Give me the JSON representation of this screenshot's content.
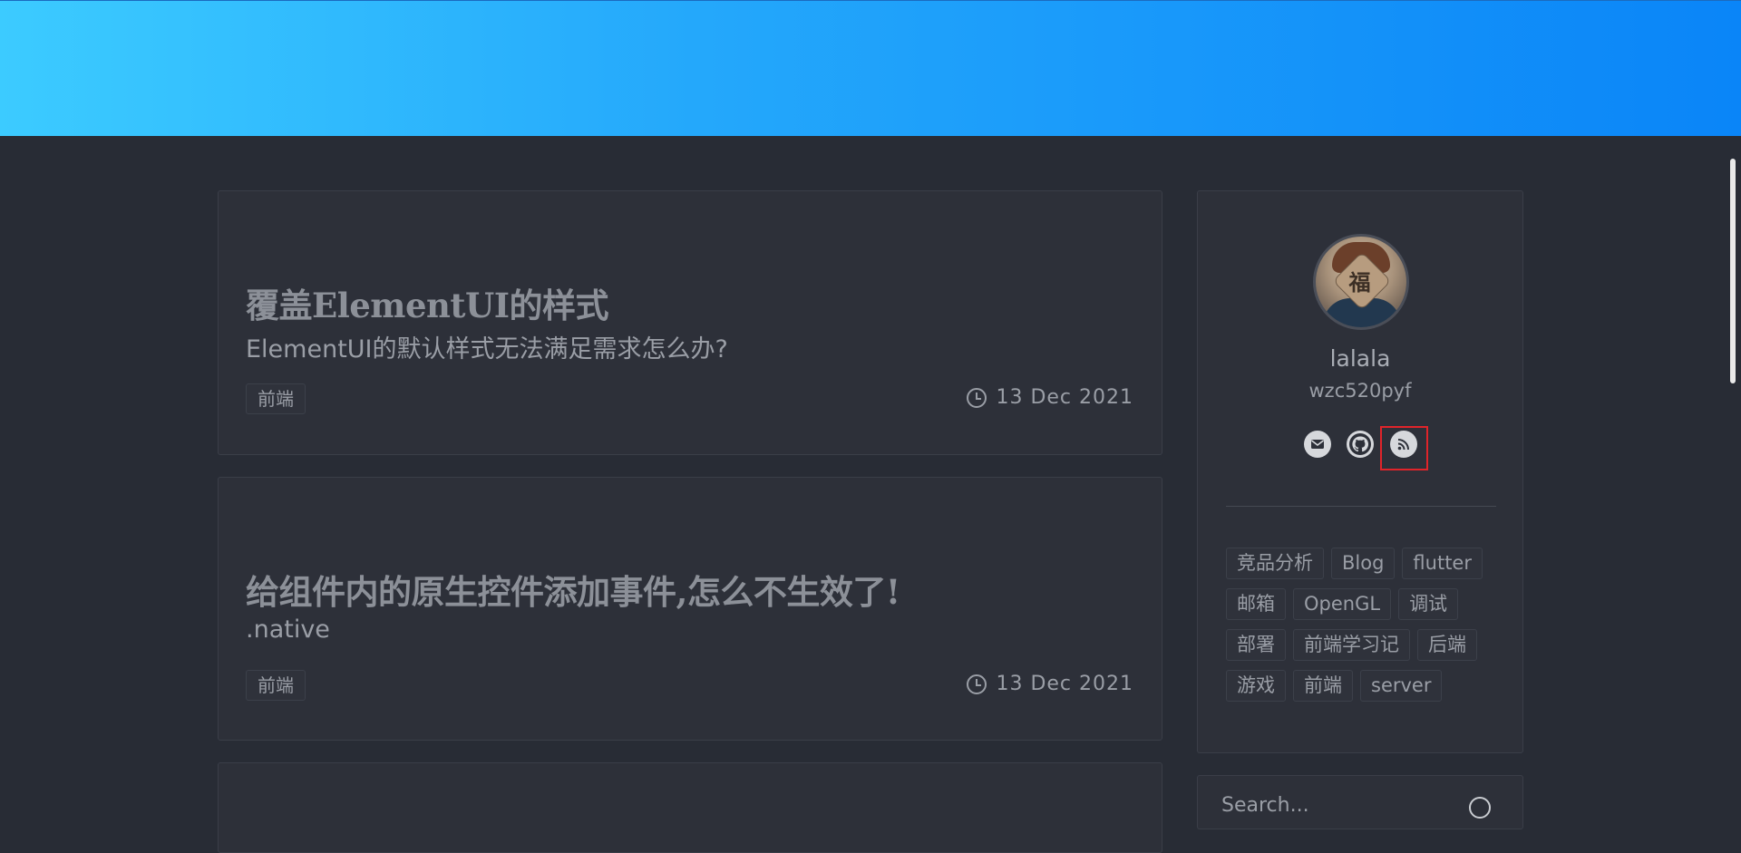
{
  "posts": [
    {
      "title": "覆盖ElementUI的样式",
      "subtitle": "ElementUI的默认样式无法满足需求怎么办?",
      "tag": "前端",
      "date": "13 Dec 2021"
    },
    {
      "title": "给组件内的原生控件添加事件,怎么不生效了!",
      "subtitle": ".native",
      "tag": "前端",
      "date": "13 Dec 2021"
    }
  ],
  "profile": {
    "name": "lalala",
    "handle": "wzc520pyf",
    "avatar_icon": "avatar-fu-character",
    "social": [
      "email-icon",
      "github-icon",
      "rss-icon"
    ]
  },
  "tags": [
    "竞品分析",
    "Blog",
    "flutter",
    "邮箱",
    "OpenGL",
    "调试",
    "部署",
    "前端学习记",
    "后端",
    "游戏",
    "前端",
    "server"
  ],
  "search": {
    "placeholder": "Search..."
  },
  "colors": {
    "banner_start": "#3ccbff",
    "banner_end": "#0a85f8",
    "page_bg": "#282c35",
    "card_bg": "#2d3039",
    "highlight": "#e0242a"
  }
}
